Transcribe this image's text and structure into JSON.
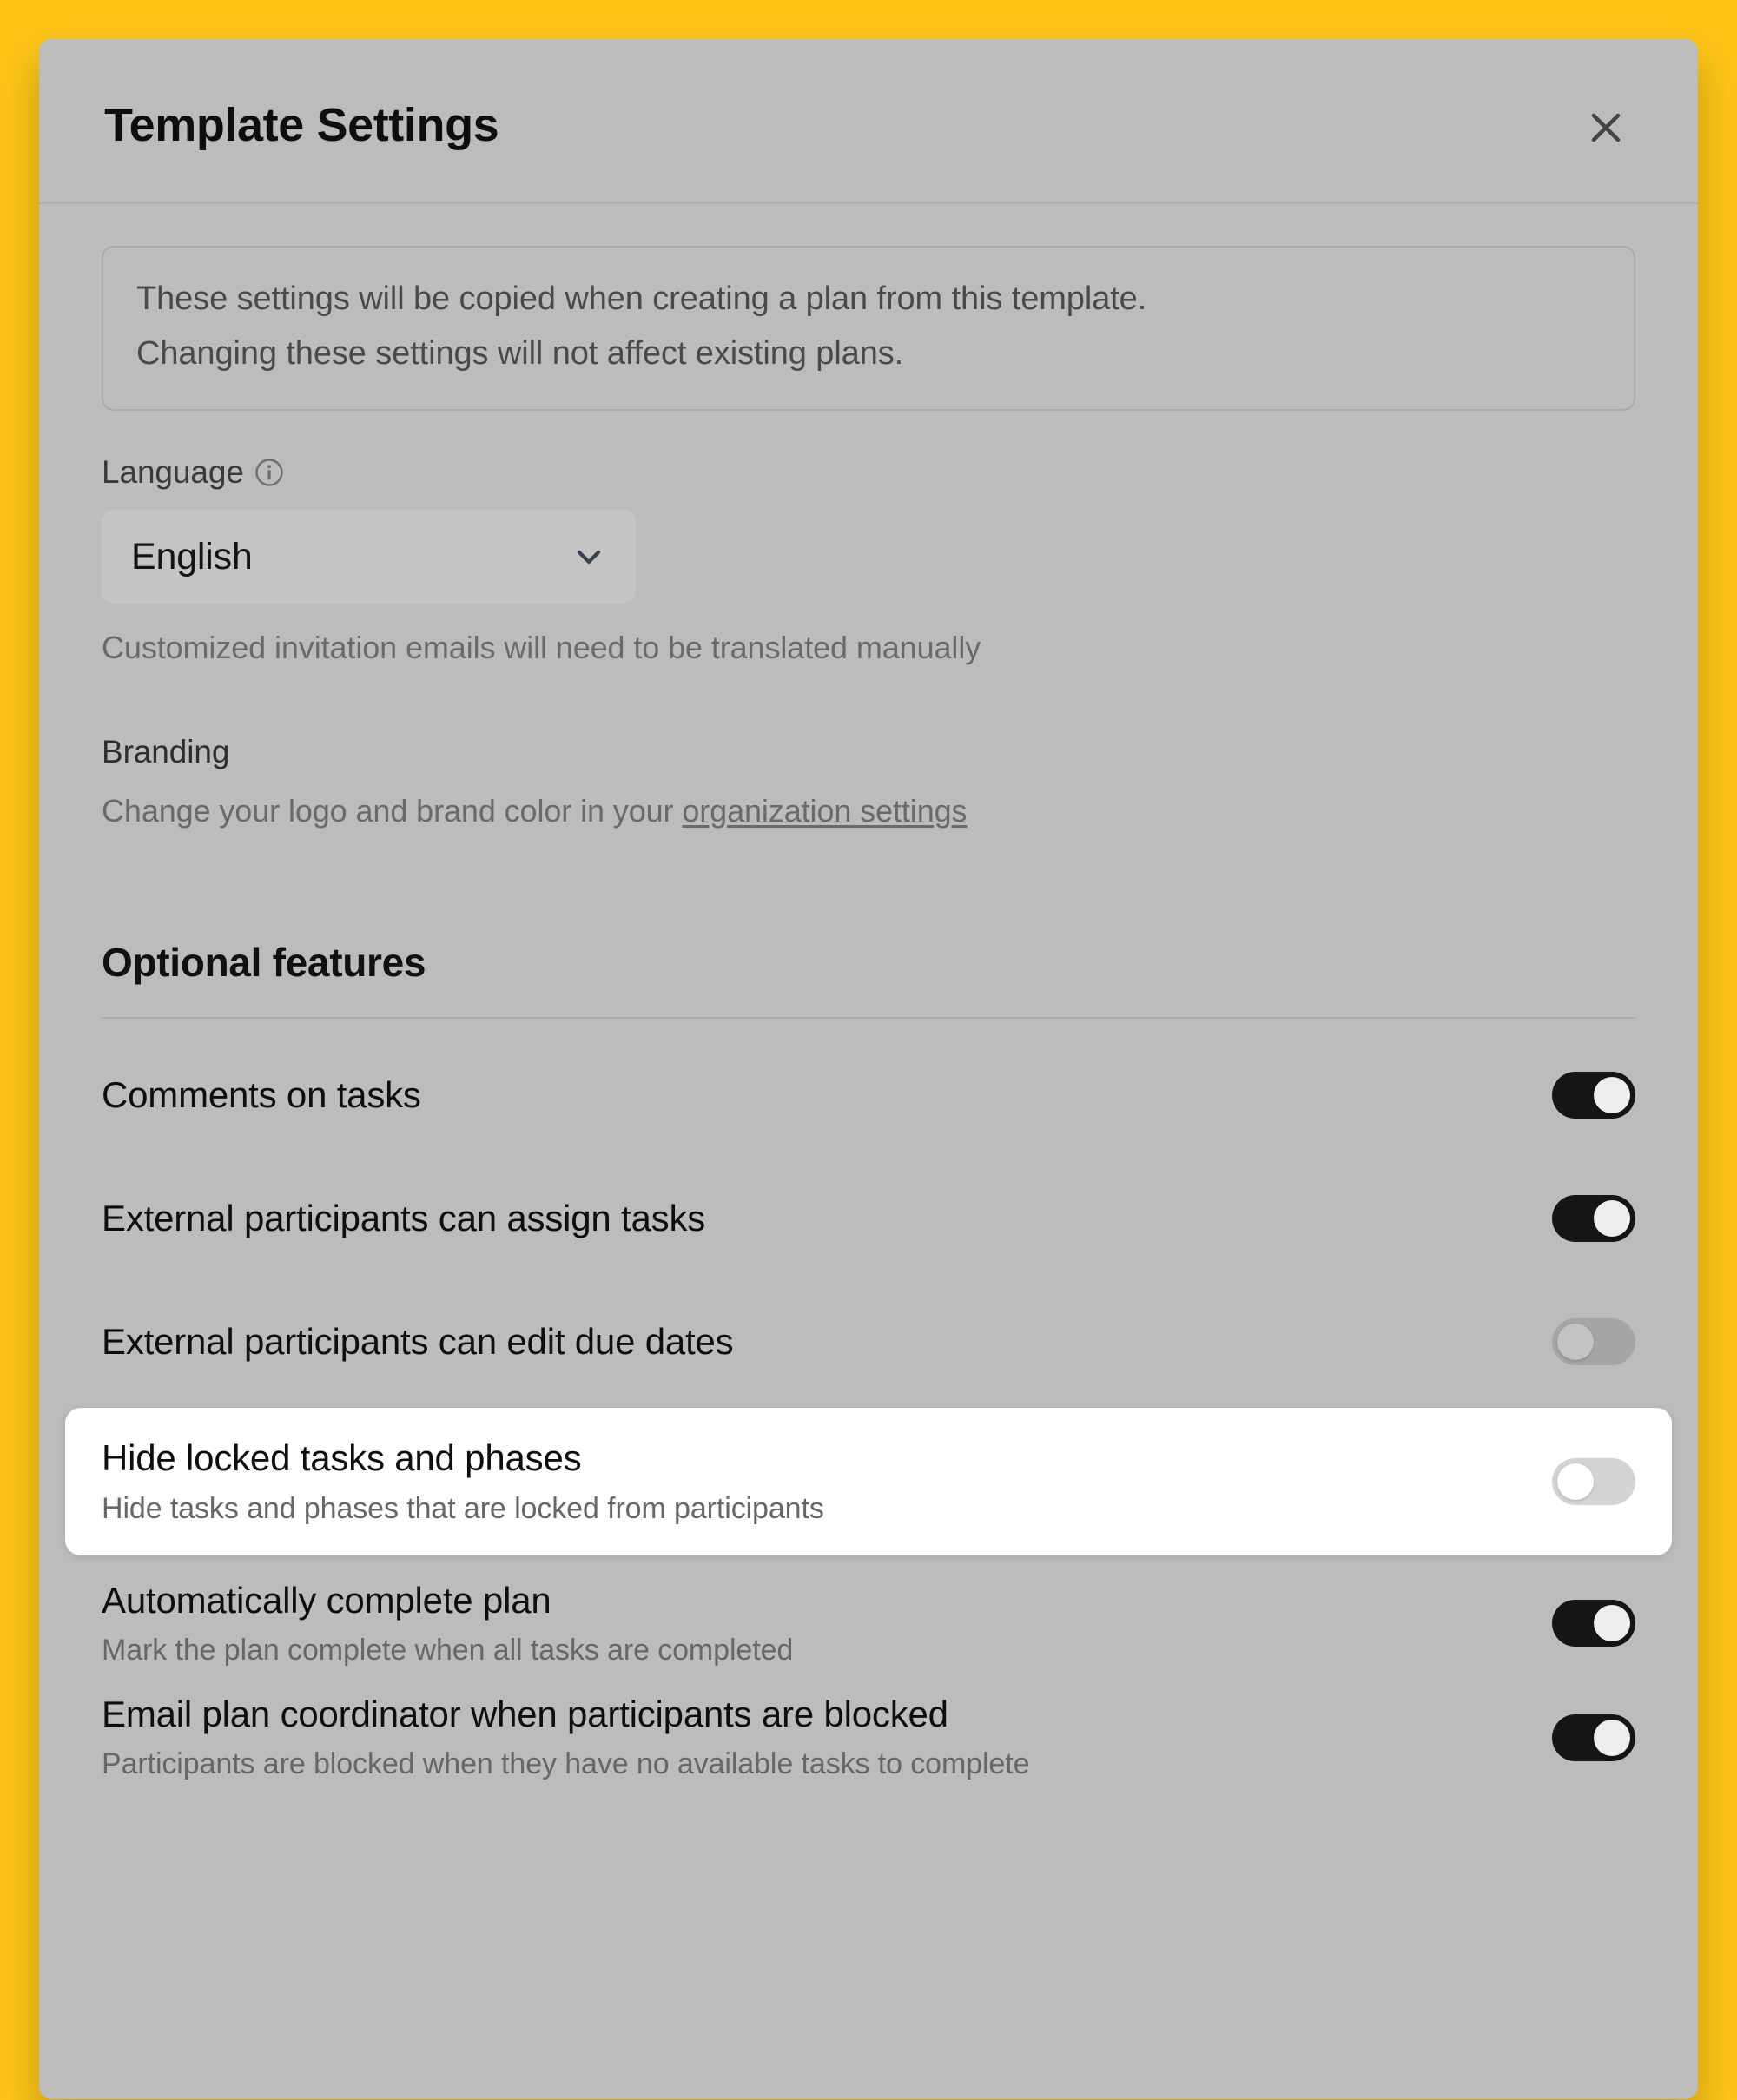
{
  "theme": {
    "page_background": "#FCC417",
    "modal_background": "#BCBCBC",
    "highlight_row_background": "#FFFFFF",
    "toggle_on_color": "#151515",
    "toggle_off_color": "#A5A5A5"
  },
  "modal": {
    "title": "Template Settings",
    "close_icon": "close-icon",
    "notice": {
      "line1": "These settings will be copied when creating a plan from this template.",
      "line2": "Changing these settings will not affect existing plans."
    },
    "language": {
      "label": "Language",
      "info_icon": "info-circle-icon",
      "selected_value": "English",
      "chevron_icon": "chevron-down-icon",
      "hint": "Customized invitation emails will need to be translated manually"
    },
    "branding": {
      "title": "Branding",
      "description_prefix": "Change your logo and brand color in your ",
      "link_text": "organization settings"
    },
    "optional_features": {
      "heading": "Optional features",
      "rows": [
        {
          "title": "Comments on tasks",
          "description": "",
          "enabled": true,
          "highlighted": false
        },
        {
          "title": "External participants can assign tasks",
          "description": "",
          "enabled": true,
          "highlighted": false
        },
        {
          "title": "External participants can edit due dates",
          "description": "",
          "enabled": false,
          "highlighted": false
        },
        {
          "title": "Hide locked tasks and phases",
          "description": "Hide tasks and phases that are locked from participants",
          "enabled": false,
          "highlighted": true
        },
        {
          "title": "Automatically complete plan",
          "description": "Mark the plan complete when all tasks are completed",
          "enabled": true,
          "highlighted": false
        },
        {
          "title": "Email plan coordinator when participants are blocked",
          "description": "Participants are blocked when they have no available tasks to complete",
          "enabled": true,
          "highlighted": false
        }
      ]
    }
  }
}
